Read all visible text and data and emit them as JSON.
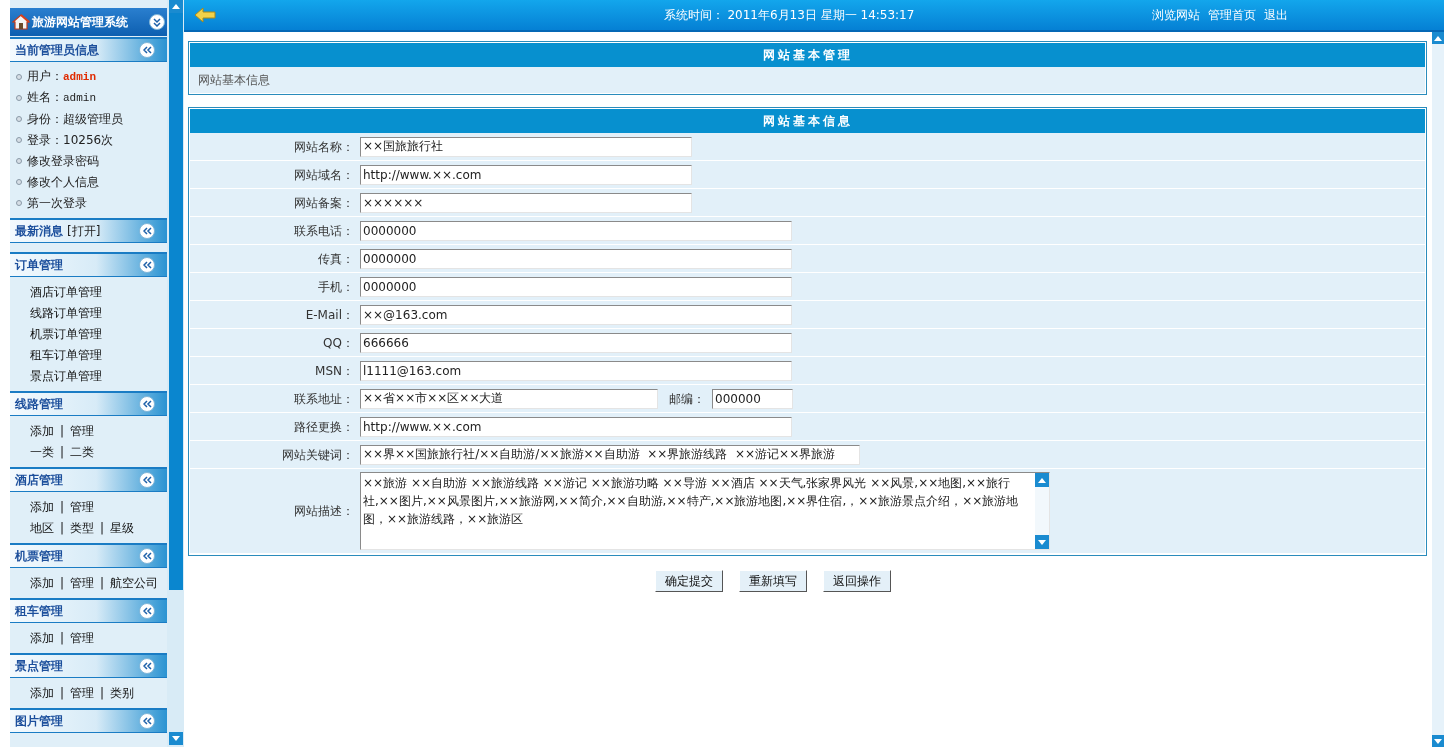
{
  "sidebar": {
    "title": "旅游网站管理系统",
    "sections": [
      {
        "title": "当前管理员信息",
        "kind": "info",
        "items": [
          {
            "label": "用户：",
            "value": "admin",
            "highlight": true
          },
          {
            "label": "姓名：",
            "value": "admin",
            "highlight": false
          },
          {
            "label": "身份：超级管理员"
          },
          {
            "label": "登录：10256次"
          },
          {
            "label": "修改登录密码"
          },
          {
            "label": "修改个人信息"
          },
          {
            "label": "第一次登录"
          }
        ]
      },
      {
        "title": "最新消息",
        "extra": "[打开]",
        "kind": "empty"
      },
      {
        "title": "订单管理",
        "kind": "list",
        "items": [
          {
            "label": "酒店订单管理"
          },
          {
            "label": "线路订单管理"
          },
          {
            "label": "机票订单管理"
          },
          {
            "label": "租车订单管理"
          },
          {
            "label": "景点订单管理"
          }
        ]
      },
      {
        "title": "线路管理",
        "kind": "links",
        "rows": [
          [
            "添加",
            "|",
            "管理"
          ],
          [
            "一类",
            "|",
            "二类"
          ]
        ]
      },
      {
        "title": "酒店管理",
        "kind": "links",
        "rows": [
          [
            "添加",
            "|",
            "管理"
          ],
          [
            "地区",
            "|",
            "类型",
            "|",
            "星级"
          ]
        ]
      },
      {
        "title": "机票管理",
        "kind": "links",
        "rows": [
          [
            "添加",
            "|",
            "管理",
            "|",
            "航空公司"
          ]
        ]
      },
      {
        "title": "租车管理",
        "kind": "links",
        "rows": [
          [
            "添加",
            "|",
            "管理"
          ]
        ]
      },
      {
        "title": "景点管理",
        "kind": "links",
        "rows": [
          [
            "添加",
            "|",
            "管理",
            "|",
            "类别"
          ]
        ]
      },
      {
        "title": "图片管理",
        "kind": "cut"
      }
    ]
  },
  "topbar": {
    "time_label": "系统时间：",
    "time": "2011年6月13日 星期一 14:53:17",
    "links": [
      "浏览网站",
      "管理首页",
      "退出"
    ]
  },
  "panel_basic": {
    "title": "网站基本管理",
    "text": "网站基本信息"
  },
  "panel_form": {
    "title": "网站基本信息",
    "rows": [
      {
        "kind": "short",
        "label": "网站名称：",
        "value": "××国旅旅行社"
      },
      {
        "kind": "short",
        "label": "网站域名：",
        "value": "http://www.××.com"
      },
      {
        "kind": "short",
        "label": "网站备案：",
        "value": "××××××"
      },
      {
        "kind": "long",
        "label": "联系电话：",
        "value": "0000000"
      },
      {
        "kind": "long",
        "label": "传真：",
        "value": "0000000"
      },
      {
        "kind": "long",
        "label": "手机：",
        "value": "0000000"
      },
      {
        "kind": "long",
        "label": "E-Mail：",
        "value": "××@163.com"
      },
      {
        "kind": "long",
        "label": "QQ：",
        "value": "666666"
      },
      {
        "kind": "long",
        "label": "MSN：",
        "value": "l1111@163.com"
      },
      {
        "kind": "address",
        "label": "联系地址：",
        "value": "××省××市××区××大道",
        "postcode_label": "邮编：",
        "postcode": "000000"
      },
      {
        "kind": "long",
        "label": "路径更换：",
        "value": "http://www.××.com"
      },
      {
        "kind": "wide",
        "label": "网站关键词：",
        "value": "××界××国旅旅行社/××自助游/××旅游××自助游  ××界旅游线路  ××游记××界旅游"
      },
      {
        "kind": "textarea",
        "label": "网站描述：",
        "value": "××旅游  ××自助游  ××旅游线路  ××游记  ××旅游功略  ××导游  ××酒店  ××天气,张家界风光  ××风景,××地图,××旅行社,××图片,××风景图片,××旅游网,××简介,××自助游,××特产,××旅游地图,××界住宿,，××旅游景点介绍，××旅游地图，××旅游线路，××旅游区"
      }
    ]
  },
  "buttons": [
    "确定提交",
    "重新填写",
    "返回操作"
  ]
}
